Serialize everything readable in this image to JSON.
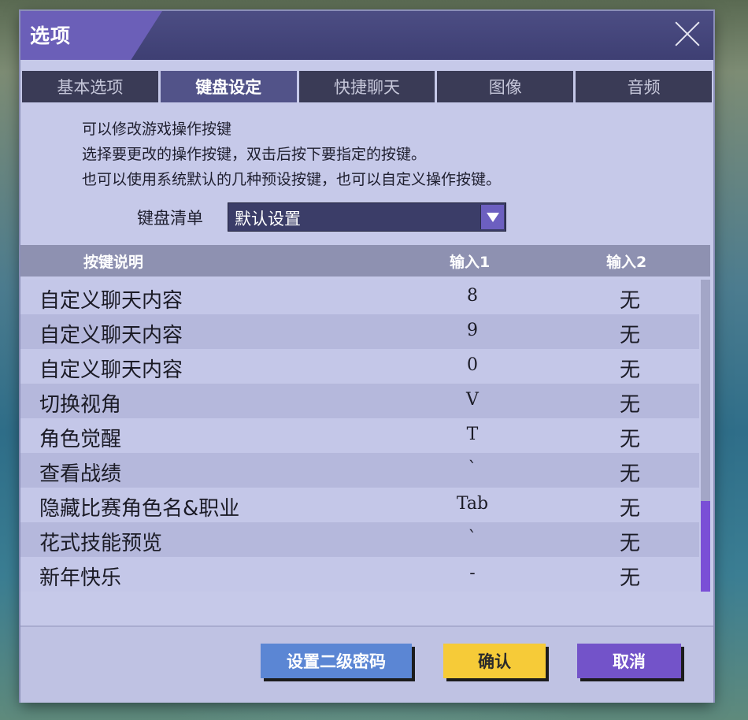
{
  "window": {
    "title": "选项"
  },
  "tabs": [
    {
      "label": "基本选项",
      "active": false
    },
    {
      "label": "键盘设定",
      "active": true
    },
    {
      "label": "快捷聊天",
      "active": false
    },
    {
      "label": "图像",
      "active": false
    },
    {
      "label": "音频",
      "active": false
    }
  ],
  "description": {
    "line1": "可以修改游戏操作按键",
    "line2": "选择要更改的操作按键，双击后按下要指定的按键。",
    "line3": "也可以使用系统默认的几种预设按键，也可以自定义操作按键。"
  },
  "keyboard_list": {
    "label": "键盘清单",
    "value": "默认设置"
  },
  "table": {
    "headers": {
      "name": "按键说明",
      "input1": "输入1",
      "input2": "输入2"
    },
    "rows": [
      {
        "name": "自定义聊天内容",
        "input1": "8",
        "input2": "无"
      },
      {
        "name": "自定义聊天内容",
        "input1": "9",
        "input2": "无"
      },
      {
        "name": "自定义聊天内容",
        "input1": "0",
        "input2": "无"
      },
      {
        "name": "切换视角",
        "input1": "V",
        "input2": "无"
      },
      {
        "name": "角色觉醒",
        "input1": "T",
        "input2": "无"
      },
      {
        "name": "查看战绩",
        "input1": "`",
        "input2": "无"
      },
      {
        "name": "隐藏比赛角色名&职业",
        "input1": "Tab",
        "input2": "无"
      },
      {
        "name": "花式技能预览",
        "input1": "`",
        "input2": "无"
      },
      {
        "name": "新年快乐",
        "input1": "-",
        "input2": "无"
      }
    ]
  },
  "buttons": {
    "set_password": "设置二级密码",
    "confirm": "确认",
    "cancel": "取消"
  },
  "colors": {
    "accent": "#6b5fb8",
    "confirm": "#f6cb38",
    "cancel": "#7353c9",
    "password": "#5b86d4"
  },
  "icons": {
    "close": "close-icon",
    "dropdown": "chevron-down-icon"
  }
}
